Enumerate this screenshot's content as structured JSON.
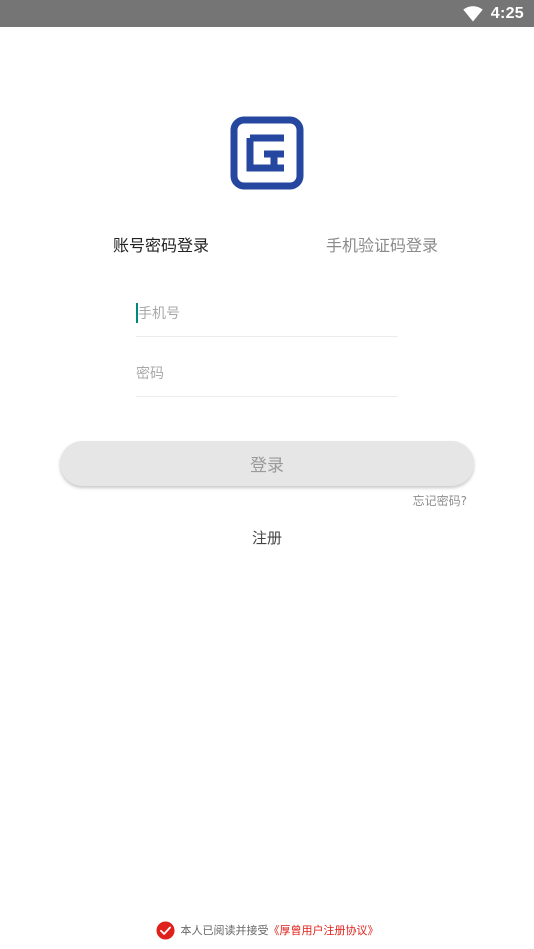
{
  "status_bar": {
    "time": "4:25",
    "icons": [
      "wifi-icon"
    ],
    "background_color": "#757575"
  },
  "logo": {
    "icon": "app-logo-icon",
    "color": "#2647a0"
  },
  "tabs": [
    {
      "label": "账号密码登录",
      "active": true
    },
    {
      "label": "手机验证码登录",
      "active": false
    }
  ],
  "form": {
    "phone_placeholder": "手机号",
    "phone_value": "",
    "password_placeholder": "密码",
    "password_value": ""
  },
  "login_button": {
    "label": "登录"
  },
  "forgot_password": "忘记密码?",
  "register": "注册",
  "agreement": {
    "checked": true,
    "text": "本人已阅读并接受",
    "link_text": "《厚曾用户注册协议》",
    "link_color": "#e0211b"
  },
  "colors": {
    "accent": "#00897b",
    "button_bg": "#e6e6e6"
  }
}
